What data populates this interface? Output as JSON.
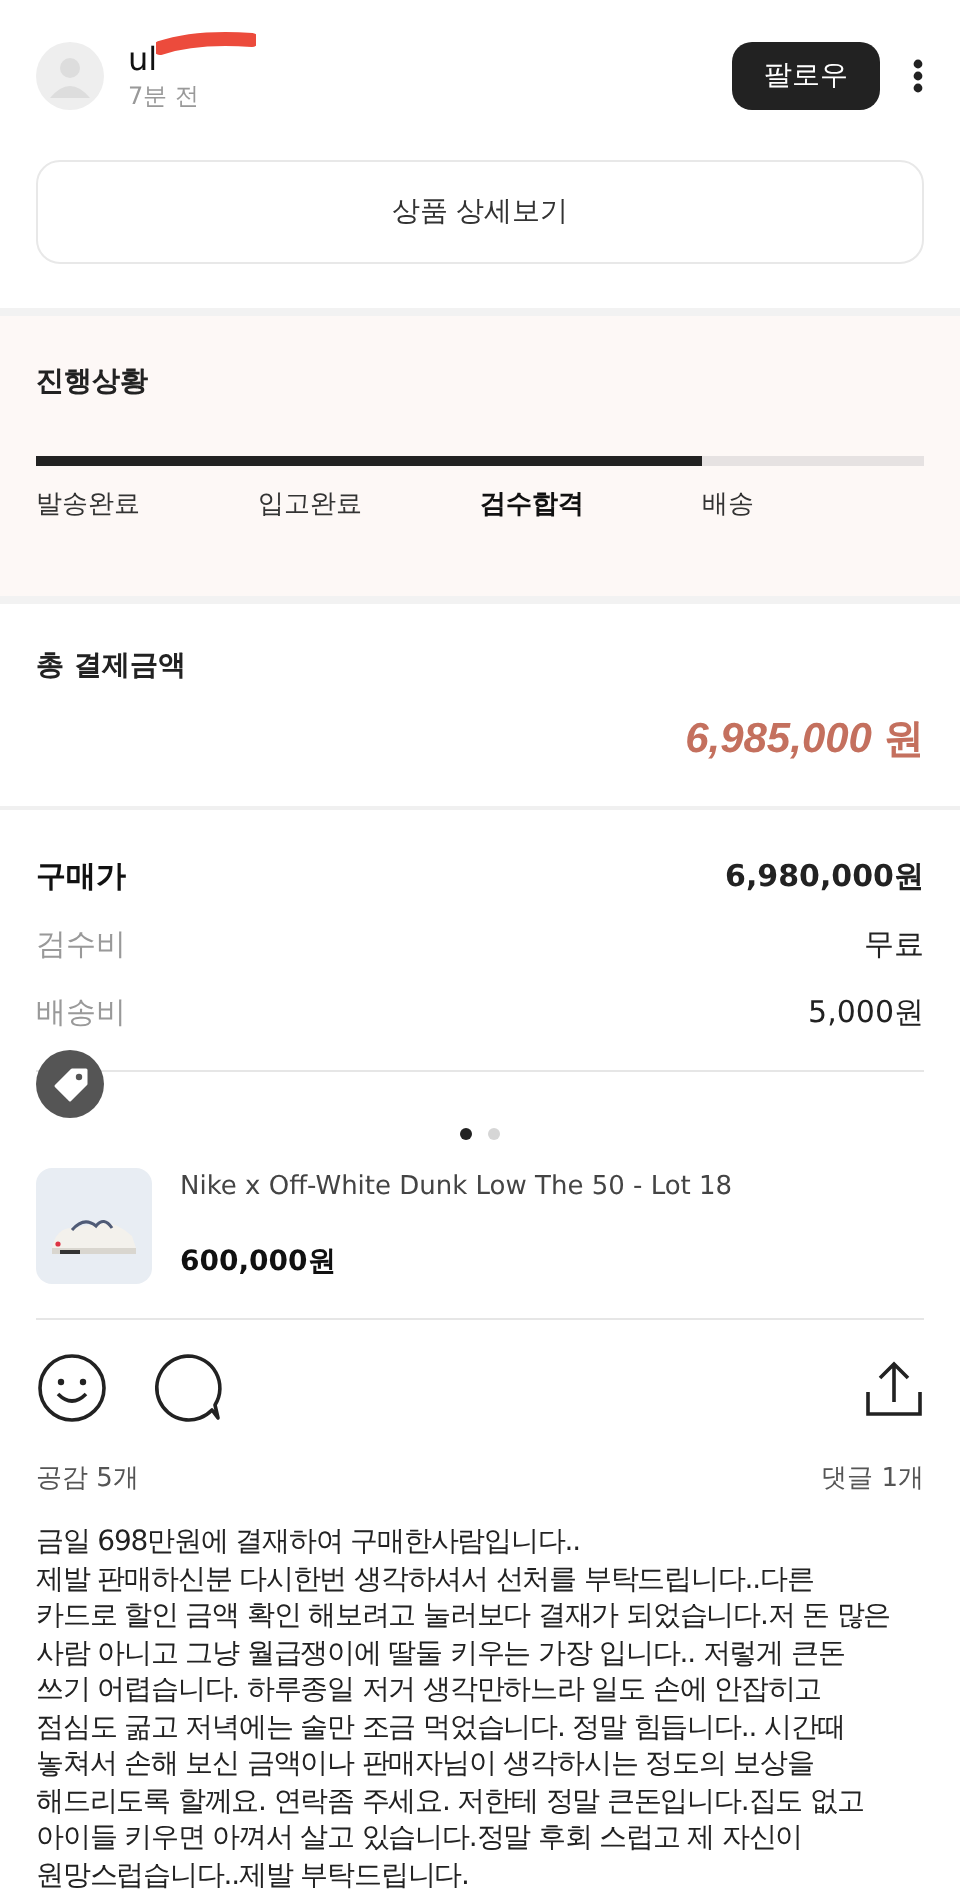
{
  "post": {
    "username": "ul",
    "time": "7분 전",
    "follow_button": "팔로우"
  },
  "detail_button": "상품 상세보기",
  "progress": {
    "title": "진행상황",
    "level": 0.75,
    "steps": [
      {
        "label": "발송완료",
        "selected": false
      },
      {
        "label": "입고완료",
        "selected": false
      },
      {
        "label": "검수합격",
        "selected": true
      },
      {
        "label": "배송",
        "selected": false
      }
    ]
  },
  "total": {
    "label": "총 결제금액",
    "amount": "6,985,000",
    "unit": "원"
  },
  "fees": [
    {
      "label": "구매가",
      "value": "6,980,000원",
      "kind": "strong"
    },
    {
      "label": "검수비",
      "value": "무료",
      "kind": "muted"
    },
    {
      "label": "배송비",
      "value": "5,000원",
      "kind": "muted"
    }
  ],
  "pager": [
    {
      "selected": true
    },
    {
      "selected": false
    }
  ],
  "product": {
    "name": "Nike x Off-White Dunk Low The 50 - Lot 18",
    "price": "600,000원"
  },
  "counts": {
    "likes": "공감 5개",
    "comments": "댓글 1개"
  },
  "body": "금일 698만원에 결재하여 구매한사람입니다..\n제발 판매하신분 다시한번 생각하셔서 선처를 부탁드립니다..다른\n카드로 할인 금액 확인 해보려고 눌러보다 결재가 되었습니다.저 돈 많은\n사람 아니고 그냥 월급쟁이에 딸둘 키우는 가장 입니다.. 저렇게 큰돈\n쓰기 어렵습니다. 하루종일 저거 생각만하느라 일도 손에 안잡히고\n점심도 굶고 저녁에는 술만 조금 먹었습니다. 정말 힘듭니다.. 시간때\n놓쳐서 손해 보신 금액이나 판매자님이 생각하시는 정도의 보상을\n해드리도록 할께요. 연락좀 주세요. 저한테 정말 큰돈입니다.집도 없고\n아이들 키우면 아껴서 살고 있습니다.정말 후회 스럽고 제 자신이\n원망스럽습니다..제발 부탁드립니다."
}
